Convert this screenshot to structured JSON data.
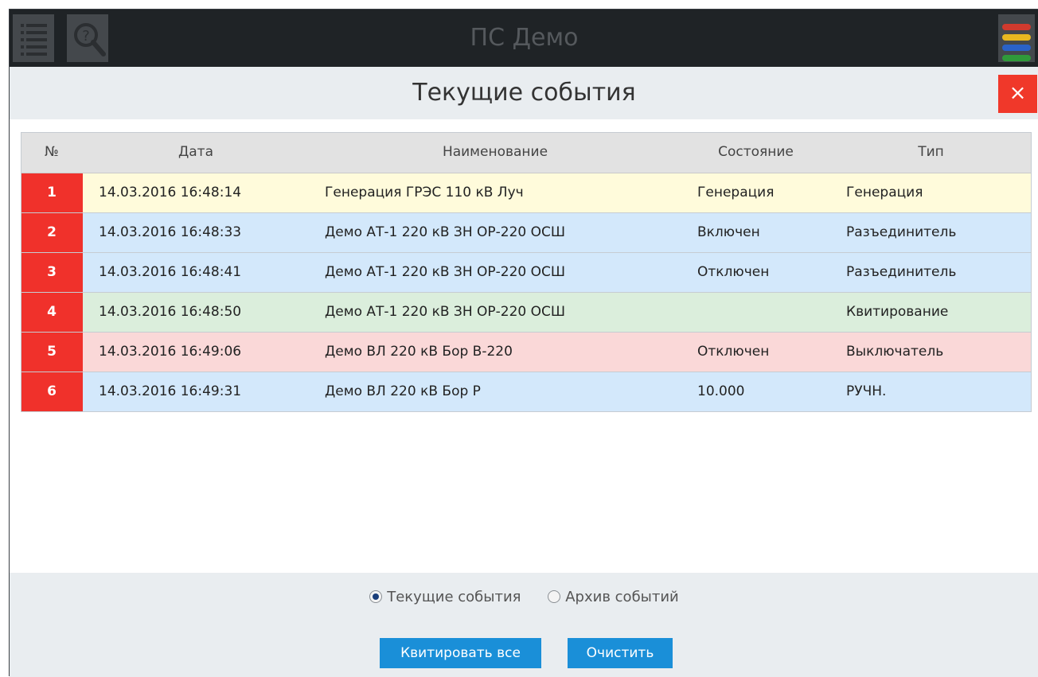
{
  "app": {
    "title": "ПС Демо"
  },
  "topbar": {
    "list_icon": "list-icon",
    "help_icon": "search-help-icon",
    "menu_icon": "color-stripes-menu-icon",
    "menu_stripe_colors": [
      "#d13a2e",
      "#e8b820",
      "#2a62c8",
      "#2f9a3a"
    ]
  },
  "dialog": {
    "title": "Текущие события",
    "close_label": "×"
  },
  "table": {
    "headers": [
      "№",
      "Дата",
      "Наименование",
      "Состояние",
      "Тип"
    ],
    "rows": [
      {
        "num": "1",
        "date": "14.03.2016 16:48:14",
        "name": "Генерация ГРЭС 110 кВ Луч",
        "state": "Генерация",
        "type": "Генерация",
        "bg": "#fffbdb"
      },
      {
        "num": "2",
        "date": "14.03.2016 16:48:33",
        "name": "Демо АТ-1 220 кВ ЗН ОР-220 ОСШ",
        "state": "Включен",
        "type": "Разъединитель",
        "bg": "#d3e8fb"
      },
      {
        "num": "3",
        "date": "14.03.2016 16:48:41",
        "name": "Демо АТ-1 220 кВ ЗН ОР-220 ОСШ",
        "state": "Отключен",
        "type": "Разъединитель",
        "bg": "#d3e8fb"
      },
      {
        "num": "4",
        "date": "14.03.2016 16:48:50",
        "name": "Демо АТ-1 220 кВ ЗН ОР-220 ОСШ",
        "state": "",
        "type": "Квитирование",
        "bg": "#dbeedc"
      },
      {
        "num": "5",
        "date": "14.03.2016 16:49:06",
        "name": "Демо ВЛ 220 кВ Бор В-220",
        "state": "Отключен",
        "type": "Выключатель",
        "bg": "#fad8d8"
      },
      {
        "num": "6",
        "date": "14.03.2016 16:49:31",
        "name": "Демо ВЛ 220 кВ Бор Р",
        "state": "10.000",
        "type": "РУЧН.",
        "bg": "#d3e8fb"
      }
    ]
  },
  "footer": {
    "radio_current": "Текущие события",
    "radio_archive": "Архив событий",
    "selected": "current",
    "ack_all_label": "Квитировать все",
    "clear_label": "Очистить"
  }
}
